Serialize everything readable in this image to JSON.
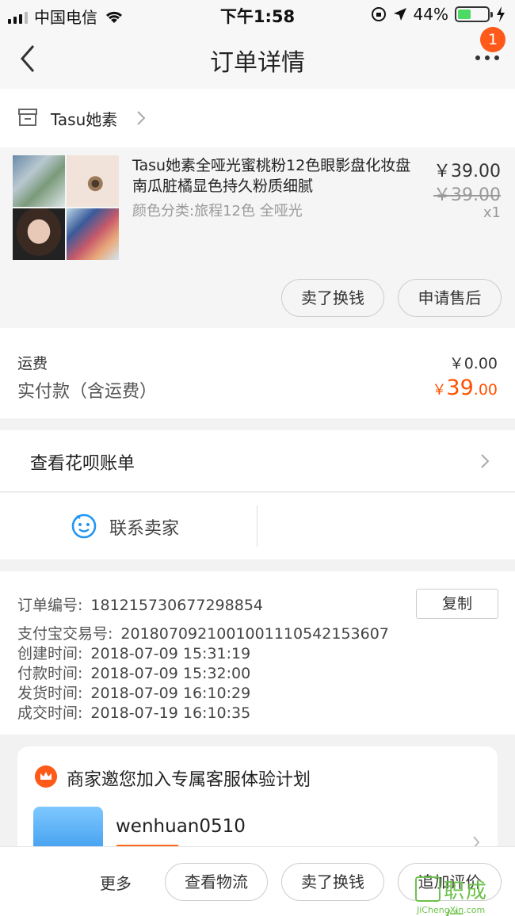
{
  "status_bar": {
    "carrier": "中国电信",
    "time": "下午1:58",
    "battery": "44%",
    "battery_level": 0.44,
    "icons": [
      "signal-icon",
      "wifi-icon",
      "rotation-lock-icon",
      "location-arrow-icon",
      "battery-icon",
      "charging-icon"
    ]
  },
  "nav": {
    "title": "订单详情",
    "badge": "1",
    "icons": [
      "back-chevron-icon",
      "more-icon"
    ]
  },
  "store": {
    "name": "Tasu她素",
    "icon": "store-icon"
  },
  "product": {
    "title": "Tasu她素全哑光蜜桃粉12色眼影盘化妆盘南瓜脏橘显色持久粉质细腻",
    "spec": "颜色分类:旅程12色 全哑光",
    "price": "￥39.00",
    "original_price": "￥39.00",
    "quantity": "x1",
    "actions": {
      "sell": "卖了换钱",
      "after_sale": "申请售后"
    }
  },
  "totals": {
    "shipping_label": "运费",
    "shipping_value": "￥0.00",
    "paid_label": "实付款（含运费）",
    "paid_currency": "￥",
    "paid_int": "39",
    "paid_dec": ".00",
    "accent": "#ff5000"
  },
  "huabei": {
    "label": "查看花呗账单"
  },
  "contact": {
    "label": "联系卖家",
    "icon": "smile-chat-icon"
  },
  "order_info": {
    "copy_label": "复制",
    "rows": [
      {
        "k": "订单编号:",
        "v": "181215730677298854"
      },
      {
        "k": "支付宝交易号:",
        "v": "2018070921001001110542153607"
      },
      {
        "k": "创建时间:",
        "v": "2018-07-09 15:31:19"
      },
      {
        "k": "付款时间:",
        "v": "2018-07-09 15:32:00"
      },
      {
        "k": "发货时间:",
        "v": "2018-07-09 16:10:29"
      },
      {
        "k": "成交时间:",
        "v": "2018-07-19 16:10:35"
      }
    ]
  },
  "service": {
    "title": "商家邀您加入专属客服体验计划",
    "username": "wenhuan0510"
  },
  "bottom": {
    "more": "更多",
    "logistics": "查看物流",
    "sell": "卖了换钱",
    "review": "追加评价"
  },
  "watermark": {
    "text": "职成信",
    "sub": "JiChengXin.com"
  }
}
